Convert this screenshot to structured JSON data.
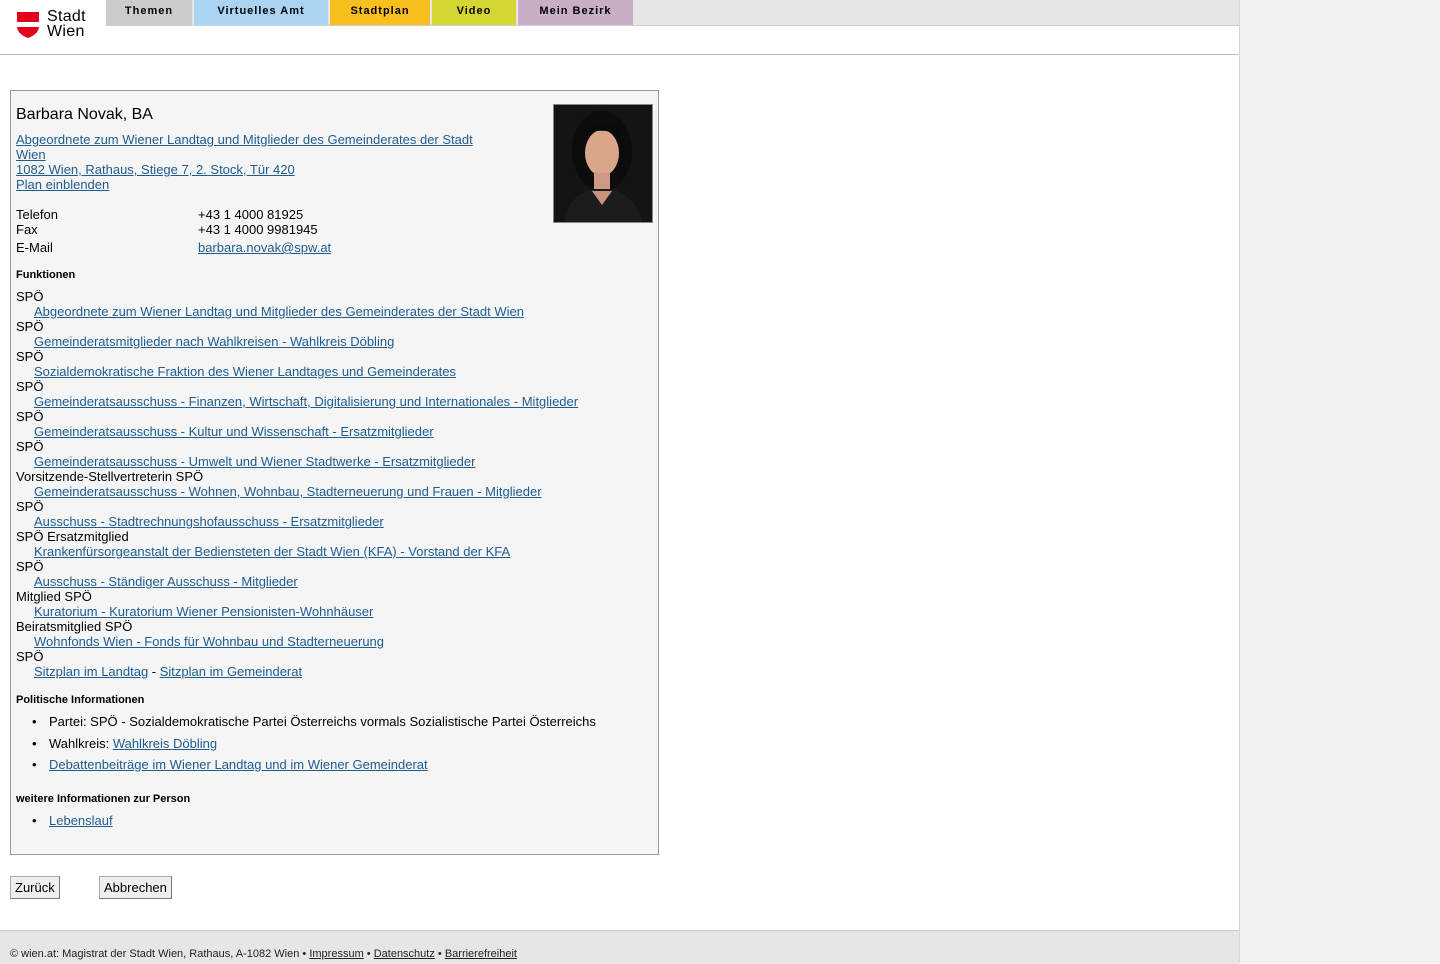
{
  "header": {
    "logo_line1": "Stadt",
    "logo_line2": "Wien",
    "nav": [
      {
        "label": "Themen",
        "color": "#cccccc"
      },
      {
        "label": "Virtuelles Amt",
        "color": "#aad4f1"
      },
      {
        "label": "Stadtplan",
        "color": "#f7c01f"
      },
      {
        "label": "Video",
        "color": "#d5d633"
      },
      {
        "label": "Mein Bezirk",
        "color": "#c9afc6"
      }
    ]
  },
  "person": {
    "name": "Barbara Novak, BA",
    "role_link": "Abgeordnete zum Wiener Landtag und Mitglieder des Gemeinderates der Stadt Wien",
    "address_link": "1082 Wien, Rathaus, Stiege 7, 2. Stock, Tür 420",
    "plan_link": "Plan einblenden",
    "contact": {
      "phone_label": "Telefon",
      "phone_value": "+43 1 4000 81925",
      "fax_label": "Fax",
      "fax_value": "+43 1 4000 9981945",
      "email_label": "E-Mail",
      "email_value": "barbara.novak@spw.at"
    }
  },
  "functions": {
    "heading": "Funktionen",
    "items": [
      {
        "label": "SPÖ",
        "link": "Abgeordnete zum Wiener Landtag und Mitglieder des Gemeinderates der Stadt Wien"
      },
      {
        "label": "SPÖ",
        "link": "Gemeinderatsmitglieder nach Wahlkreisen - Wahlkreis Döbling"
      },
      {
        "label": "SPÖ",
        "link": "Sozialdemokratische Fraktion des Wiener Landtages und Gemeinderates"
      },
      {
        "label": "SPÖ",
        "link": "Gemeinderatsausschuss - Finanzen, Wirtschaft, Digitalisierung und Internationales - Mitglieder"
      },
      {
        "label": "SPÖ",
        "link": "Gemeinderatsausschuss - Kultur und Wissenschaft - Ersatzmitglieder"
      },
      {
        "label": "SPÖ",
        "link": "Gemeinderatsausschuss - Umwelt und Wiener Stadtwerke - Ersatzmitglieder"
      },
      {
        "label": "Vorsitzende-Stellvertreterin SPÖ",
        "link": "Gemeinderatsausschuss - Wohnen, Wohnbau, Stadterneuerung und Frauen - Mitglieder"
      },
      {
        "label": "SPÖ",
        "link": "Ausschuss - Stadtrechnungshofausschuss - Ersatzmitglieder"
      },
      {
        "label": "SPÖ Ersatzmitglied",
        "link": "Krankenfürsorgeanstalt der Bediensteten der Stadt Wien (KFA) - Vorstand der KFA"
      },
      {
        "label": "SPÖ",
        "link": "Ausschuss - Ständiger Ausschuss - Mitglieder"
      },
      {
        "label": "Mitglied SPÖ",
        "link": "Kuratorium - Kuratorium Wiener Pensionisten-Wohnhäuser"
      },
      {
        "label": "Beiratsmitglied SPÖ",
        "link": "Wohnfonds Wien - Fonds für Wohnbau und Stadterneuerung"
      }
    ],
    "last_label": "SPÖ",
    "seat_link_1": "Sitzplan im Landtag",
    "seat_sep": " - ",
    "seat_link_2": "Sitzplan im Gemeinderat"
  },
  "political": {
    "heading": "Politische Informationen",
    "party": "Partei: SPÖ - Sozialdemokratische Partei Österreichs vormals Sozialistische Partei Österreichs",
    "wahlkreis_label": "Wahlkreis: ",
    "wahlkreis_link": "Wahlkreis Döbling",
    "debate_link": "Debattenbeiträge im Wiener Landtag und im Wiener Gemeinderat"
  },
  "further": {
    "heading": "weitere Informationen zur Person",
    "cv_link": "Lebenslauf"
  },
  "buttons": {
    "back": "Zurück",
    "cancel": "Abbrechen"
  },
  "footer": {
    "copyright": "© wien.at: Magistrat der Stadt Wien, Rathaus, A-1082 Wien • ",
    "impressum": "Impressum",
    "sep": " • ",
    "datenschutz": "Datenschutz",
    "barrierefreiheit": "Barrierefreiheit"
  }
}
